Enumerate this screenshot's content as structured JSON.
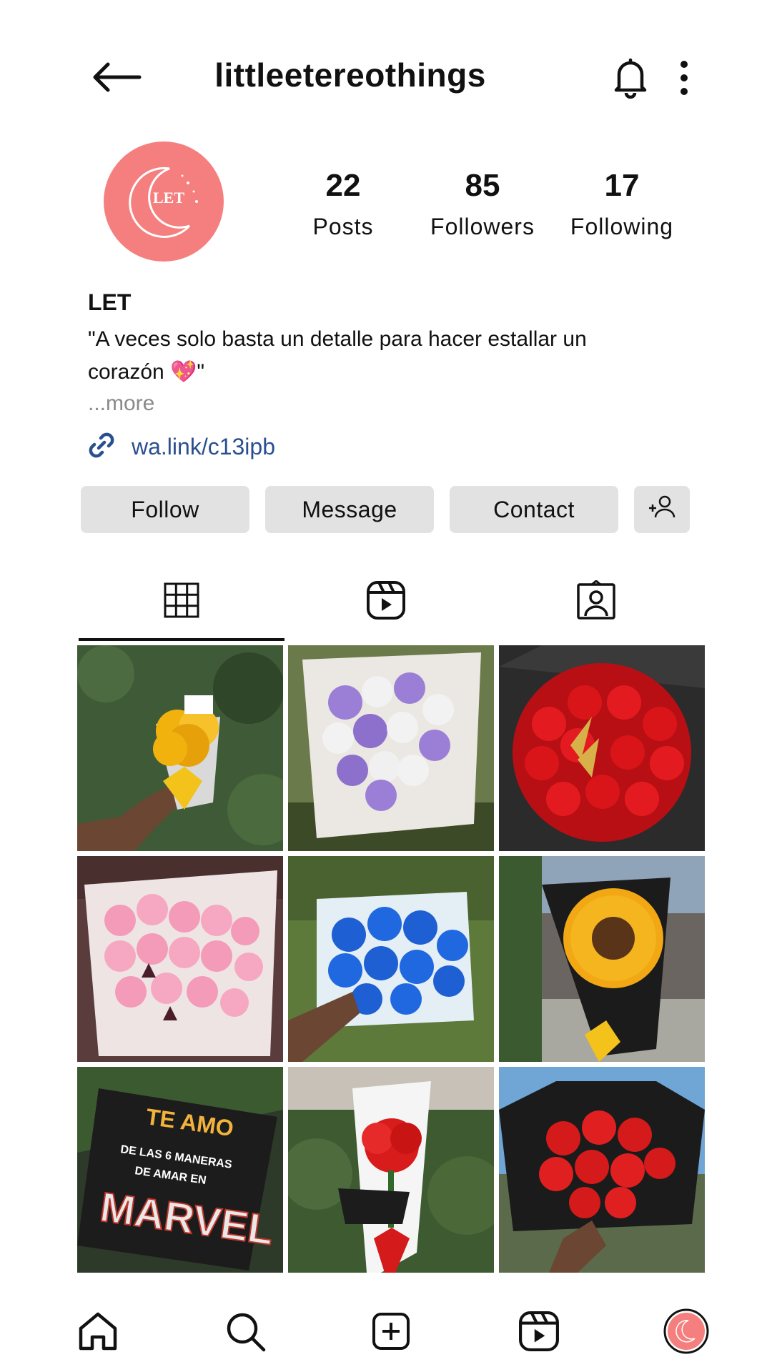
{
  "header": {
    "username": "littleetereothings"
  },
  "profile": {
    "avatar_text": "LET",
    "stats": [
      {
        "value": "22",
        "label": "Posts"
      },
      {
        "value": "85",
        "label": "Followers"
      },
      {
        "value": "17",
        "label": "Following"
      }
    ],
    "name": "LET",
    "bio": "\"A veces solo basta un detalle para hacer estallar un corazón 💖\"",
    "more": "...more",
    "link": "wa.link/c13ipb"
  },
  "actions": {
    "follow": "Follow",
    "message": "Message",
    "contact": "Contact"
  },
  "tabs": [
    "grid-icon",
    "reels-icon",
    "tagged-icon"
  ],
  "posts": [
    {
      "name": "yellow-rose-bouquet",
      "bg": "#3f5a36",
      "flower": "#f2b20e"
    },
    {
      "name": "purple-white-rose-bouquet",
      "bg": "#6b7a4a",
      "flower": "#9b7fd6"
    },
    {
      "name": "red-rose-box",
      "bg": "#2b2b2b",
      "flower": "#d9151a"
    },
    {
      "name": "pink-rose-bouquet",
      "bg": "#5a3c3c",
      "flower": "#f39bb8"
    },
    {
      "name": "blue-rose-bouquet",
      "bg": "#5d7a3a",
      "flower": "#1e5fd4"
    },
    {
      "name": "sunflower-bouquet",
      "bg": "#7d8a6a",
      "flower": "#f2a814"
    },
    {
      "name": "te-amo-marvel-box",
      "bg": "#2d3a2a",
      "flower": "#1a1a1a"
    },
    {
      "name": "single-red-rose",
      "bg": "#3d5a30",
      "flower": "#d81b1b"
    },
    {
      "name": "black-red-rose-bouquet",
      "bg": "#6fa6d6",
      "flower": "#d41a1a"
    }
  ],
  "marvel_box": {
    "line1": "TE AMO",
    "line2": "DE LAS 6 MANERAS",
    "line3": "DE AMAR EN",
    "line4": "MARVEL"
  },
  "bottom_nav": [
    "home-icon",
    "search-icon",
    "create-icon",
    "reels-icon",
    "profile-avatar"
  ],
  "colors": {
    "avatar": "#f57f7f",
    "link": "#2a4f8f",
    "button": "#e2e2e2"
  }
}
